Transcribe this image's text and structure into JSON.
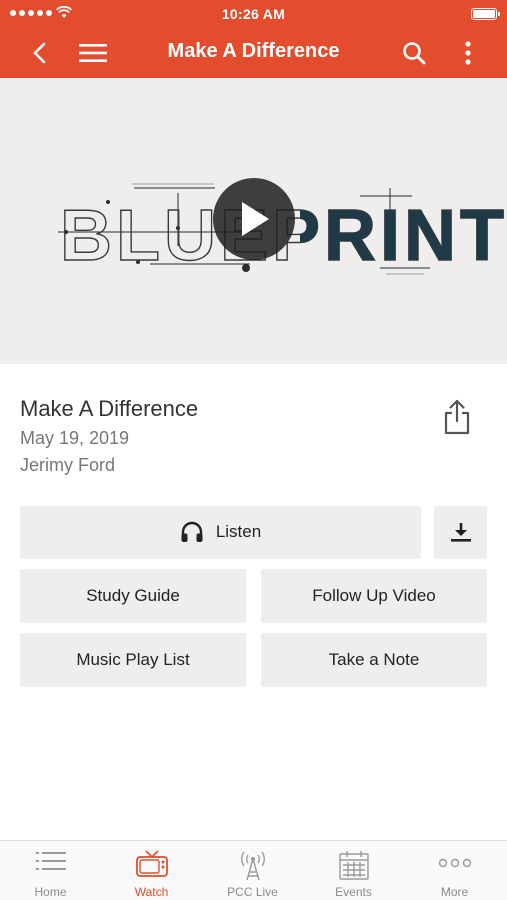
{
  "status": {
    "time": "10:26 AM"
  },
  "nav": {
    "title": "Make A Difference"
  },
  "hero": {
    "artwork_text": "BLUEPRINT"
  },
  "sermon": {
    "title": "Make A Difference",
    "date": "May 19, 2019",
    "speaker": "Jerimy Ford"
  },
  "actions": {
    "listen": "Listen",
    "study_guide": "Study Guide",
    "follow_up_video": "Follow Up Video",
    "music_play_list": "Music Play List",
    "take_a_note": "Take a Note"
  },
  "tabs": [
    {
      "label": "Home",
      "icon": "list-icon",
      "active": false
    },
    {
      "label": "Watch",
      "icon": "tv-icon",
      "active": true
    },
    {
      "label": "PCC Live",
      "icon": "broadcast-tower-icon",
      "active": false
    },
    {
      "label": "Events",
      "icon": "calendar-icon",
      "active": false
    },
    {
      "label": "More",
      "icon": "more-dots-icon",
      "active": false
    }
  ],
  "colors": {
    "accent": "#e44c2e",
    "button_bg": "#edeef0",
    "dark_teal": "#1f3a46"
  }
}
